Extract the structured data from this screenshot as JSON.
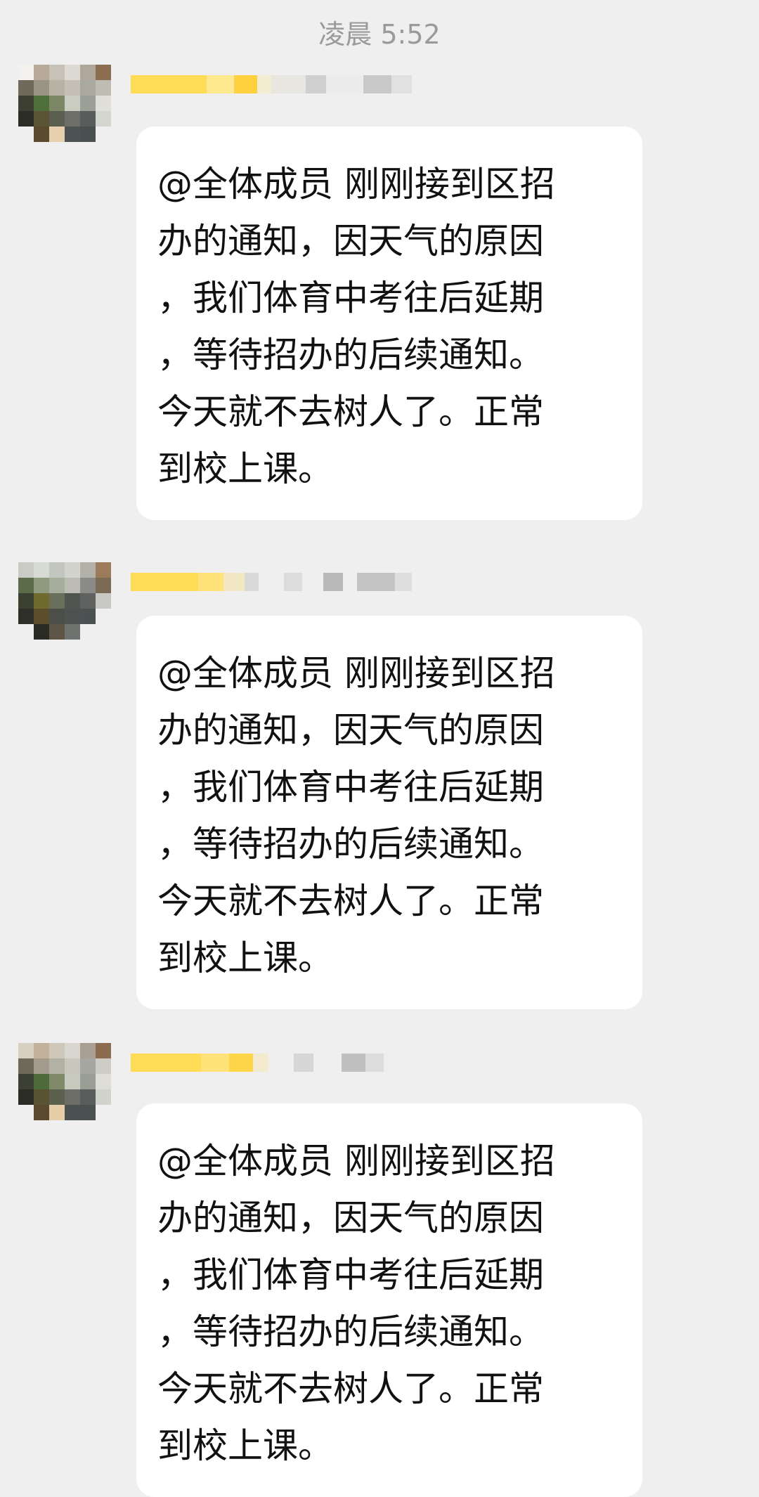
{
  "timestamp": "凌晨 5:52",
  "messages": [
    {
      "sender": "",
      "lines": [
        "@全体成员 刚刚接到区招",
        "办的通知，因天气的原因",
        "，我们体育中考往后延期",
        "，等待招办的后续通知。",
        "今天就不去树人了。正常",
        "到校上课。"
      ]
    },
    {
      "sender": "",
      "lines": [
        "@全体成员 刚刚接到区招",
        "办的通知，因天气的原因",
        "，我们体育中考往后延期",
        "，等待招办的后续通知。",
        "今天就不去树人了。正常",
        "到校上课。"
      ]
    },
    {
      "sender": "",
      "lines": [
        "@全体成员 刚刚接到区招",
        "办的通知，因天气的原因",
        "，我们体育中考往后延期",
        "，等待招办的后续通知。",
        "今天就不去树人了。正常",
        "到校上课。"
      ]
    }
  ],
  "colors": {
    "background": "#efefef",
    "bubble": "#ffffff",
    "timestamp": "#9a9a9a",
    "name_blur": "#ffd84a"
  }
}
